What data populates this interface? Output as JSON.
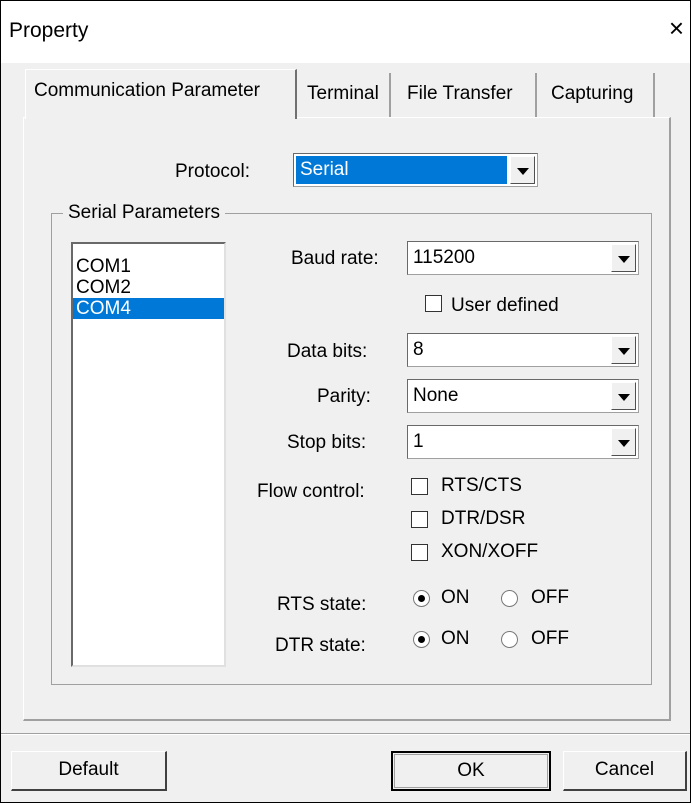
{
  "window": {
    "title": "Property",
    "close_glyph": "×"
  },
  "tabs": [
    {
      "label": "Communication Parameter",
      "active": true
    },
    {
      "label": "Terminal",
      "active": false
    },
    {
      "label": "File Transfer",
      "active": false
    },
    {
      "label": "Capturing",
      "active": false
    }
  ],
  "protocol": {
    "label": "Protocol:",
    "value": "Serial"
  },
  "serial_parameters": {
    "group_title": "Serial Parameters",
    "ports": [
      "COM1",
      "COM2",
      "COM4"
    ],
    "selected_port": "COM4",
    "baud_rate": {
      "label": "Baud rate:",
      "value": "115200"
    },
    "user_defined": {
      "label": "User defined",
      "checked": false
    },
    "data_bits": {
      "label": "Data bits:",
      "value": "8"
    },
    "parity": {
      "label": "Parity:",
      "value": "None"
    },
    "stop_bits": {
      "label": "Stop bits:",
      "value": "1"
    },
    "flow_control": {
      "label": "Flow control:",
      "options": [
        {
          "label": "RTS/CTS",
          "checked": false
        },
        {
          "label": "DTR/DSR",
          "checked": false
        },
        {
          "label": "XON/XOFF",
          "checked": false
        }
      ]
    },
    "rts_state": {
      "label": "RTS state:",
      "on_label": "ON",
      "off_label": "OFF",
      "value": "ON"
    },
    "dtr_state": {
      "label": "DTR state:",
      "on_label": "ON",
      "off_label": "OFF",
      "value": "ON"
    }
  },
  "buttons": {
    "default_label": "Default",
    "ok_label": "OK",
    "cancel_label": "Cancel"
  },
  "colors": {
    "selection": "#0078d7",
    "dialog_bg": "#f0f0f0"
  }
}
